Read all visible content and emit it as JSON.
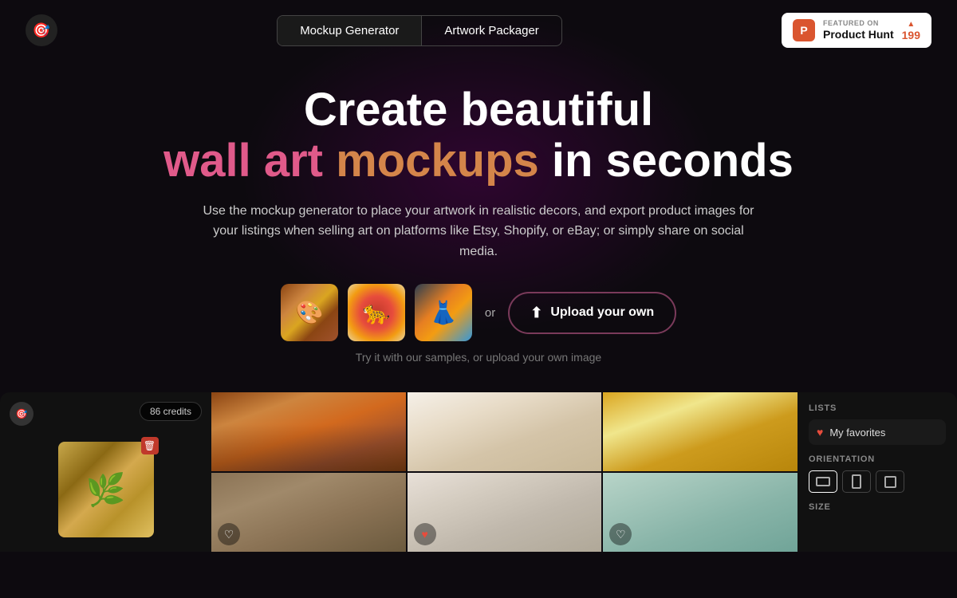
{
  "header": {
    "logo_symbol": "🎯",
    "nav": {
      "tab1": "Mockup Generator",
      "tab2": "Artwork Packager"
    },
    "product_hunt": {
      "featured_label": "FEATURED ON",
      "name": "Product Hunt",
      "count": "199",
      "logo_letter": "P"
    }
  },
  "hero": {
    "title_line1": "Create beautiful",
    "title_word_wall": "wall",
    "title_word_art": "art",
    "title_word_mockups": "mockups",
    "title_word_in_seconds": "in seconds",
    "subtitle": "Use the mockup generator to place your artwork in realistic decors, and export product images for your listings when selling art on platforms like Etsy, Shopify, or eBay; or simply share on social media.",
    "sample_hint": "Try it with our samples, or upload your own image",
    "or_label": "or",
    "upload_button": "Upload your own"
  },
  "left_panel": {
    "credits": "86 credits",
    "logo_symbol": "🎯",
    "artwork_emoji": "🌿"
  },
  "sidebar": {
    "lists_label": "LISTS",
    "favorites_label": "My favorites",
    "orientation_label": "ORIENTATION",
    "size_label": "SIZE"
  },
  "mockups": [
    {
      "id": 1,
      "has_heart": false
    },
    {
      "id": 2,
      "has_heart": false
    },
    {
      "id": 3,
      "has_heart": false
    },
    {
      "id": 4,
      "has_heart": true,
      "heart_filled": false
    },
    {
      "id": 5,
      "has_heart": true,
      "heart_filled": true
    },
    {
      "id": 6,
      "has_heart": true,
      "heart_filled": false
    }
  ]
}
